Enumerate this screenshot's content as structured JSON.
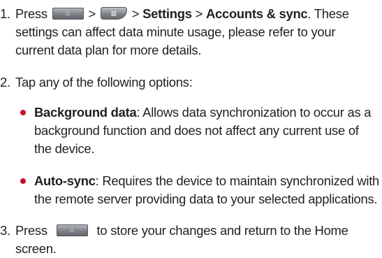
{
  "step1": {
    "number": "1.",
    "press": "Press",
    "sep1": ">",
    "sep2": ">",
    "settings": "Settings",
    "sep3": ">",
    "accounts": "Accounts & sync",
    "line1_rest": ". These",
    "line2": "settings can affect data minute usage, please refer to your",
    "line3": "current data plan for more details."
  },
  "step2": {
    "number": "2.",
    "text": "Tap any of the following options:",
    "options": [
      {
        "term": "Background data",
        "line1": ": Allows data synchronization to occur as a",
        "line2": "background function and does not affect any current use of",
        "line3": "the device."
      },
      {
        "term": "Auto-sync",
        "line1": ": Requires the device to maintain synchronized with",
        "line2": "the remote server providing data to your selected applications."
      }
    ]
  },
  "step3": {
    "number": "3.",
    "press": "Press",
    "line1_rest": "to store your changes and return to the Home",
    "line2": "screen."
  },
  "icons": {
    "home_key": "home-key-icon",
    "menu_key": "menu-key-icon",
    "bullet_color": "#c8102e"
  }
}
